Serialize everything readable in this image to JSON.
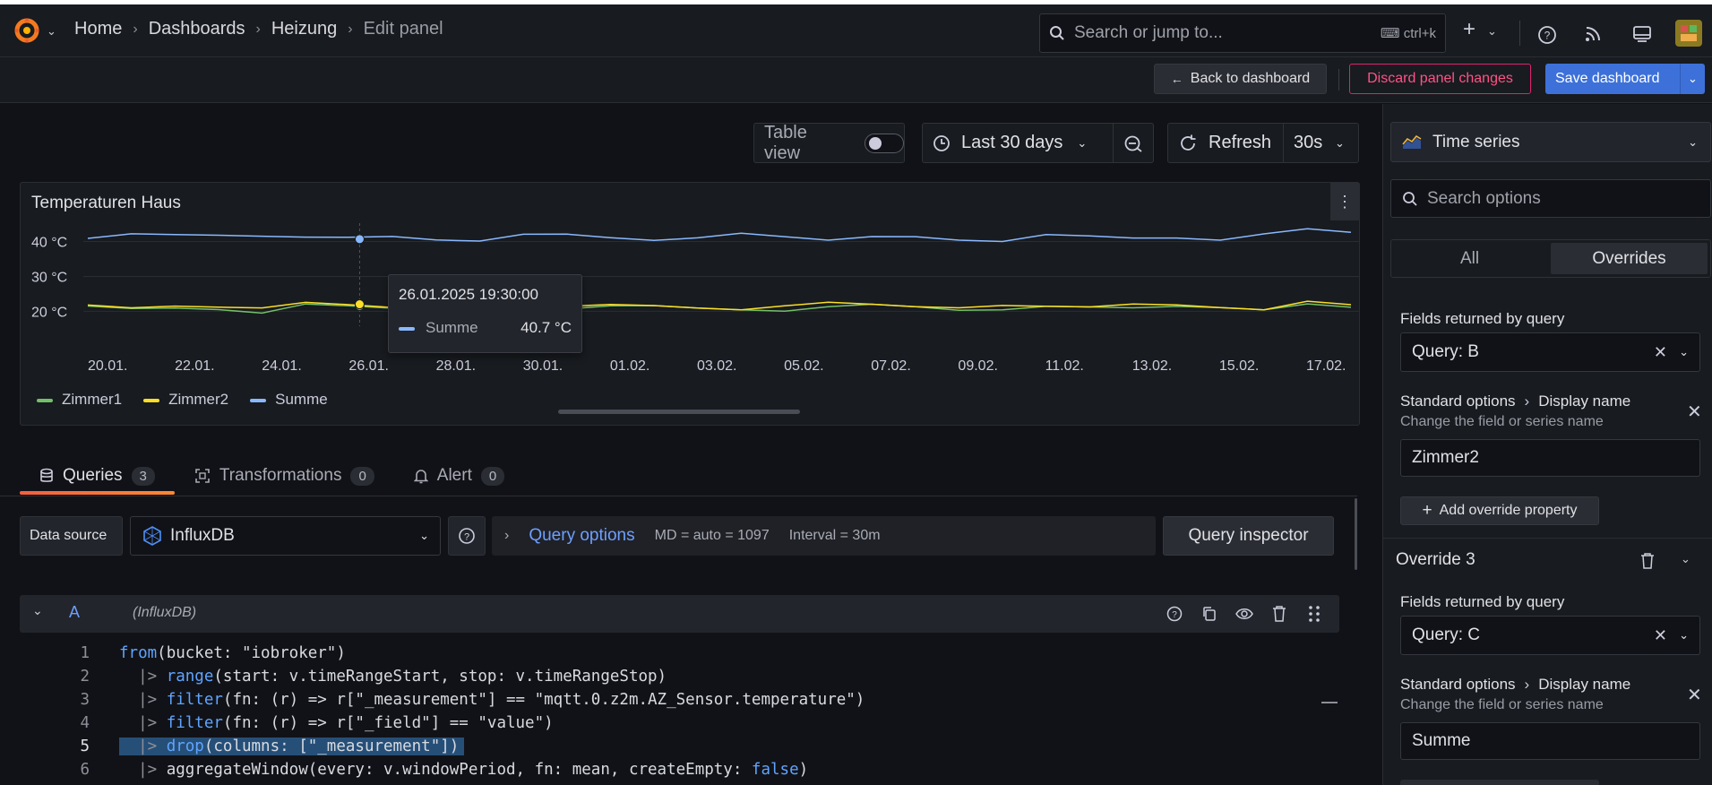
{
  "breadcrumb": {
    "items": [
      "Home",
      "Dashboards",
      "Heizung"
    ],
    "current": "Edit panel"
  },
  "search": {
    "placeholder": "Search or jump to...",
    "shortcut": "ctrl+k"
  },
  "toolbar": {
    "back_label": "Back to dashboard",
    "discard_label": "Discard panel changes",
    "save_label": "Save dashboard"
  },
  "panel_controls": {
    "table_view_label": "Table view",
    "time_range": "Last 30 days",
    "refresh_label": "Refresh",
    "refresh_interval": "30s"
  },
  "chart_data": {
    "type": "line",
    "title": "Temperaturen Haus",
    "xlabel": "",
    "ylabel": "",
    "x_ticks": [
      "20.01.",
      "22.01.",
      "24.01.",
      "26.01.",
      "28.01.",
      "30.01.",
      "01.02.",
      "03.02.",
      "05.02.",
      "07.02.",
      "09.02.",
      "11.02.",
      "13.02.",
      "15.02.",
      "17.02."
    ],
    "y_ticks": [
      "20 °C",
      "30 °C",
      "40 °C"
    ],
    "ylim": [
      17,
      44
    ],
    "legend": "bottom-left",
    "series": [
      {
        "name": "Zimmer1",
        "color": "#73bf69",
        "values": [
          21,
          20.5,
          21.5,
          21,
          20,
          21.5,
          21,
          20.5,
          21,
          21.5,
          21,
          20.5,
          21,
          22,
          21.5,
          21,
          20.5,
          21,
          21.5,
          21,
          20,
          21,
          21.5,
          21,
          20.5,
          21,
          21.5,
          21,
          22,
          21
        ]
      },
      {
        "name": "Zimmer2",
        "color": "#fade2a",
        "values": [
          21.5,
          21,
          22,
          21.5,
          21,
          22,
          21.5,
          21,
          21.5,
          22,
          21.5,
          21,
          21.5,
          22,
          21.5,
          21,
          21.5,
          22,
          21.5,
          21,
          21.5,
          22,
          21.5,
          21,
          21.5,
          22,
          21.5,
          21,
          22.5,
          21.5
        ]
      },
      {
        "name": "Summe",
        "color": "#8ab8ff",
        "values": [
          41,
          42.5,
          42,
          41.5,
          41,
          40.7,
          41.5,
          42,
          41,
          40.5,
          41.5,
          42,
          41,
          40.5,
          41.5,
          42,
          41,
          40,
          41.5,
          42,
          41,
          40.5,
          41.5,
          41,
          40.5,
          41.5,
          41,
          42,
          43.5,
          42.5
        ]
      }
    ]
  },
  "tooltip": {
    "time": "26.01.2025 19:30:00",
    "series": "Summe",
    "value": "40.7 °C"
  },
  "tabs": [
    {
      "label": "Queries",
      "count": "3"
    },
    {
      "label": "Transformations",
      "count": "0"
    },
    {
      "label": "Alert",
      "count": "0"
    }
  ],
  "datasource": {
    "label": "Data source",
    "value": "InfluxDB",
    "query_options_label": "Query options",
    "md": "MD = auto = 1097",
    "interval": "Interval = 30m",
    "inspector_label": "Query inspector"
  },
  "query": {
    "ref": "A",
    "source": "(InfluxDB)",
    "lines": [
      {
        "n": "1",
        "fn": "from",
        "rest": "(bucket: \"iobroker\")",
        "prefix": ""
      },
      {
        "n": "2",
        "fn": "range",
        "rest": "(start: v.timeRangeStart, stop: v.timeRangeStop)",
        "prefix": "  |> "
      },
      {
        "n": "3",
        "fn": "filter",
        "rest": "(fn: (r) => r[\"_measurement\"] == \"mqtt.0.z2m.AZ_Sensor.temperature\")",
        "prefix": "  |> "
      },
      {
        "n": "4",
        "fn": "filter",
        "rest": "(fn: (r) => r[\"_field\"] == \"value\")",
        "prefix": "  |> "
      },
      {
        "n": "5",
        "fn": "drop",
        "rest": "(columns: [\"_measurement\"])",
        "prefix": "  |> "
      },
      {
        "n": "6",
        "fn": "",
        "rest": "aggregateWindow(every: v.windowPeriod, fn: mean, createEmpty: ",
        "prefix": "  |> ",
        "tail": "false",
        "close": ")"
      }
    ]
  },
  "sidebar": {
    "viz": "Time series",
    "search_placeholder": "Search options",
    "tab_all": "All",
    "tab_overrides": "Overrides",
    "override2": {
      "fields_label": "Fields returned by query",
      "fields_value": "Query: B",
      "prop_path": "Standard options",
      "prop_name": "Display name",
      "prop_desc": "Change the field or series name",
      "prop_value": "Zimmer2",
      "add_label": "Add override property"
    },
    "override3": {
      "title": "Override 3",
      "fields_label": "Fields returned by query",
      "fields_value": "Query: C",
      "prop_path": "Standard options",
      "prop_name": "Display name",
      "prop_desc": "Change the field or series name",
      "prop_value": "Summe"
    }
  }
}
